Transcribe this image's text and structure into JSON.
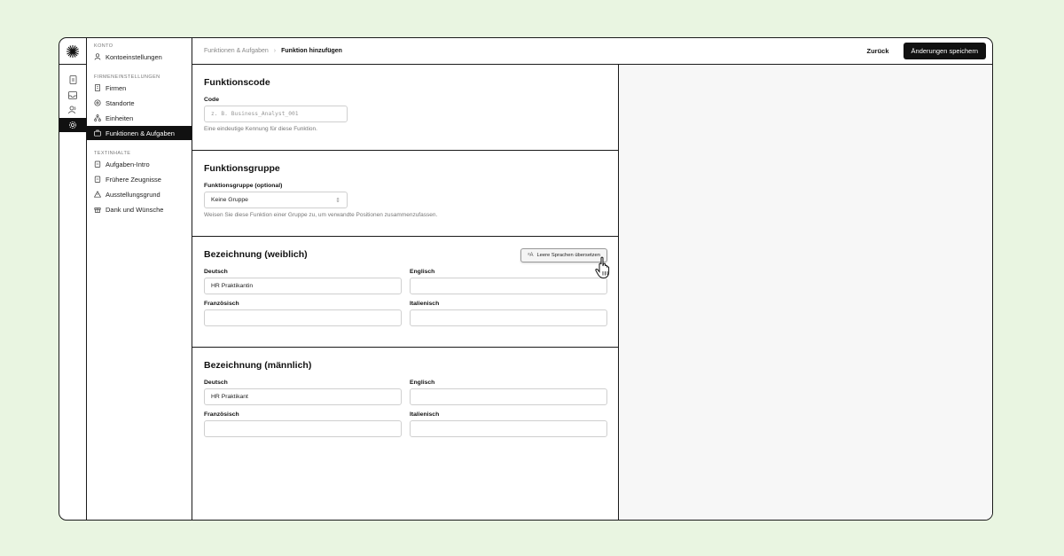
{
  "sidebar": {
    "section_account": "KONTO",
    "account_items": [
      {
        "label": "Kontoeinstellungen",
        "icon": "user-icon"
      }
    ],
    "section_company": "FIRMENEINSTELLUNGEN",
    "company_items": [
      {
        "label": "Firmen",
        "icon": "building-icon"
      },
      {
        "label": "Standorte",
        "icon": "location-icon"
      },
      {
        "label": "Einheiten",
        "icon": "org-chart-icon"
      },
      {
        "label": "Funktionen & Aufgaben",
        "icon": "briefcase-icon",
        "active": true
      }
    ],
    "section_content": "TEXTINHALTE",
    "content_items": [
      {
        "label": "Aufgaben-Intro",
        "icon": "clipboard-icon"
      },
      {
        "label": "Frühere Zeugnisse",
        "icon": "clipboard-icon"
      },
      {
        "label": "Ausstellungsgrund",
        "icon": "warning-icon"
      },
      {
        "label": "Dank und Wünsche",
        "icon": "gift-icon"
      }
    ]
  },
  "topbar": {
    "breadcrumb_parent": "Funktionen & Aufgaben",
    "breadcrumb_current": "Funktion hinzufügen",
    "back_label": "Zurück",
    "save_label": "Änderungen speichern"
  },
  "function_code": {
    "title": "Funktionscode",
    "code_label": "Code",
    "code_placeholder": "z. B. Business_Analyst_001",
    "hint": "Eine eindeutige Kennung für diese Funktion."
  },
  "function_group": {
    "title": "Funktionsgruppe",
    "label": "Funktionsgruppe (optional)",
    "selected": "Keine Gruppe",
    "hint": "Weisen Sie diese Funktion einer Gruppe zu, um verwandte Positionen zusammenzufassen."
  },
  "title_female": {
    "title": "Bezeichnung (weiblich)",
    "translate_label": "Leere Sprachen übersetzen",
    "de_label": "Deutsch",
    "de_value": "HR Praktikantin",
    "en_label": "Englisch",
    "en_value": "",
    "fr_label": "Französisch",
    "fr_value": "",
    "it_label": "Italienisch",
    "it_value": ""
  },
  "title_male": {
    "title": "Bezeichnung (männlich)",
    "de_label": "Deutsch",
    "de_value": "HR Praktikant",
    "en_label": "Englisch",
    "en_value": "",
    "fr_label": "Französisch",
    "fr_value": "",
    "it_label": "Italienisch",
    "it_value": ""
  },
  "colors": {
    "accent": "#111111",
    "background": "#e9f5e1"
  }
}
